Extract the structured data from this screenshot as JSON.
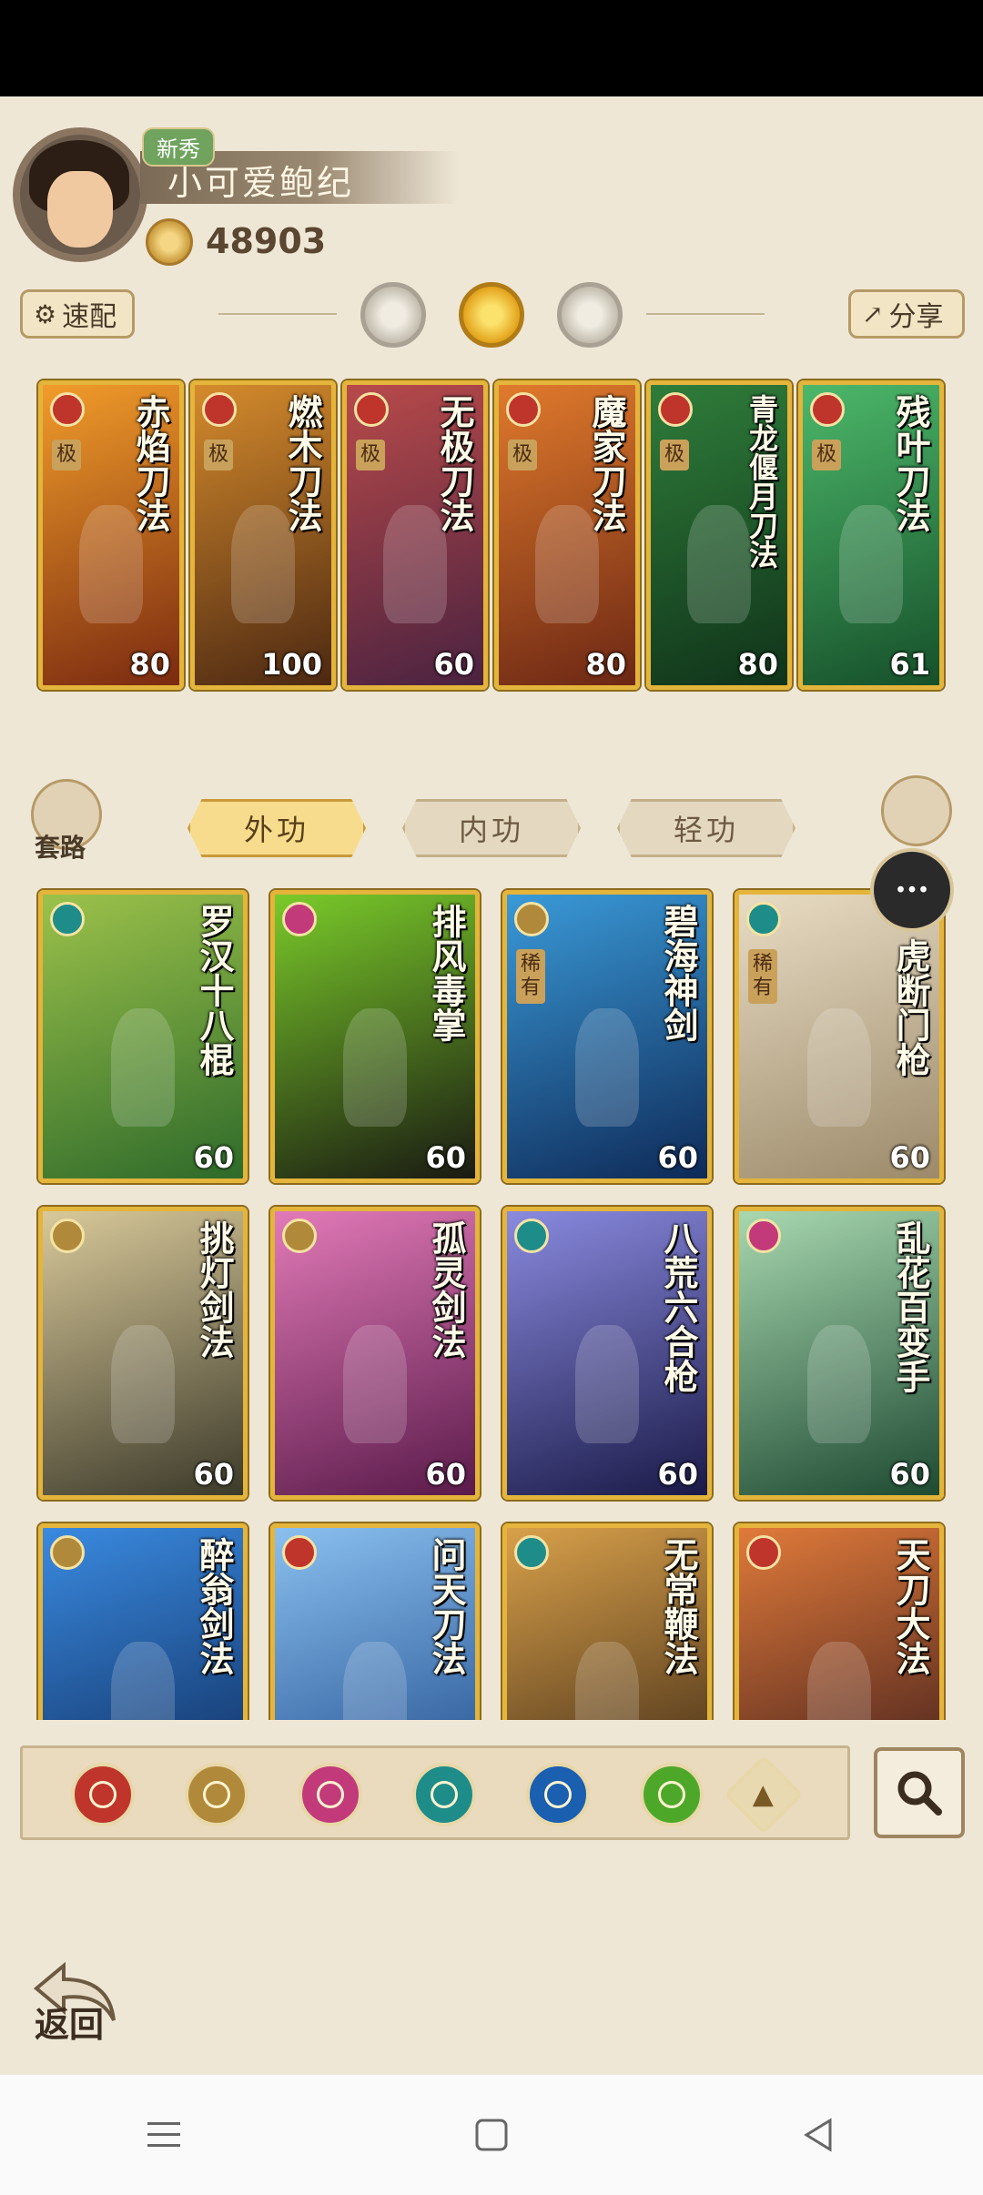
{
  "player": {
    "badge": "新秀",
    "name": "小可爱鲍纪",
    "coins": "48903"
  },
  "toolbar": {
    "quick_config_label": "速配",
    "share_label": "分享"
  },
  "equipped_skills": [
    {
      "name": "赤焰刀法",
      "level": "80",
      "grade": "极",
      "school_color": "#c0352b",
      "bg": [
        "#f19c2a",
        "#7a2a10"
      ]
    },
    {
      "name": "燃木刀法",
      "level": "100",
      "grade": "极",
      "school_color": "#c0352b",
      "bg": [
        "#d58b2c",
        "#4c2812"
      ]
    },
    {
      "name": "无极刀法",
      "level": "60",
      "grade": "极",
      "school_color": "#c0352b",
      "bg": [
        "#b84a4a",
        "#4a2240"
      ]
    },
    {
      "name": "魔家刀法",
      "level": "80",
      "grade": "极",
      "school_color": "#c0352b",
      "bg": [
        "#e07a2c",
        "#6c2714"
      ]
    },
    {
      "name": "青龙偃月刀法",
      "level": "80",
      "grade": "极",
      "school_color": "#c0352b",
      "bg": [
        "#2f7d3a",
        "#10331a"
      ]
    },
    {
      "name": "残叶刀法",
      "level": "61",
      "grade": "极",
      "school_color": "#c0352b",
      "bg": [
        "#4cb86a",
        "#16502a"
      ]
    }
  ],
  "tabs": {
    "routine": "套路",
    "external": "外功",
    "internal": "内功",
    "lightness": "轻功"
  },
  "skills_grid": [
    {
      "name": "罗汉十八棍",
      "level": "60",
      "school_color": "#1e8d8a",
      "bg": [
        "#9cc24a",
        "#2e6a2a"
      ]
    },
    {
      "name": "排风毒掌",
      "level": "60",
      "school_color": "#c23a7a",
      "bg": [
        "#7acb2a",
        "#1a1a12"
      ]
    },
    {
      "name": "碧海神剑",
      "level": "60",
      "grade": "稀有",
      "school_color": "#b08a3a",
      "bg": [
        "#3a9ad8",
        "#0e2a58"
      ]
    },
    {
      "name": "一虎断门枪",
      "level": "60",
      "grade": "稀有",
      "school_color": "#1e8d8a",
      "bg": [
        "#e8dcc4",
        "#9c8a6a"
      ]
    },
    {
      "name": "挑灯剑法",
      "level": "60",
      "school_color": "#b08a3a",
      "bg": [
        "#d9c99a",
        "#3c3a2a"
      ]
    },
    {
      "name": "孤灵剑法",
      "level": "60",
      "school_color": "#b08a3a",
      "bg": [
        "#e27ab8",
        "#5a1a4a"
      ]
    },
    {
      "name": "八荒六合枪",
      "level": "60",
      "school_color": "#1e8d8a",
      "bg": [
        "#8a8ae0",
        "#1a1a48"
      ]
    },
    {
      "name": "乱花百变手",
      "level": "60",
      "school_color": "#c23a7a",
      "bg": [
        "#a8d8b0",
        "#1e4a32"
      ]
    },
    {
      "name": "醉翁剑法",
      "level": "",
      "school_color": "#b08a3a",
      "bg": [
        "#3a8ae0",
        "#0e2a5a"
      ]
    },
    {
      "name": "问天刀法",
      "level": "",
      "school_color": "#c0352b",
      "bg": [
        "#8ac0f0",
        "#1e4a8a"
      ]
    },
    {
      "name": "无常鞭法",
      "level": "",
      "school_color": "#1e8d8a",
      "bg": [
        "#d8a04a",
        "#3a2614"
      ]
    },
    {
      "name": "天刀大法",
      "level": "",
      "school_color": "#c0352b",
      "bg": [
        "#e07a3a",
        "#3a1a1a"
      ]
    }
  ],
  "school_filters": [
    {
      "icon": "blade-school-icon",
      "color": "#c0352b"
    },
    {
      "icon": "sword-school-icon",
      "color": "#b08a3a"
    },
    {
      "icon": "fist-school-icon",
      "color": "#c23a7a"
    },
    {
      "icon": "fan-school-icon",
      "color": "#1e8d8a"
    },
    {
      "icon": "taiji-school-icon",
      "color": "#1a5fb0"
    },
    {
      "icon": "leaf-school-icon",
      "color": "#4da82a"
    }
  ],
  "back_label": "返回",
  "colors": {
    "background": "#efe7d6",
    "card_border": "#e4b53a",
    "active_tab": "#f7dc8d"
  }
}
